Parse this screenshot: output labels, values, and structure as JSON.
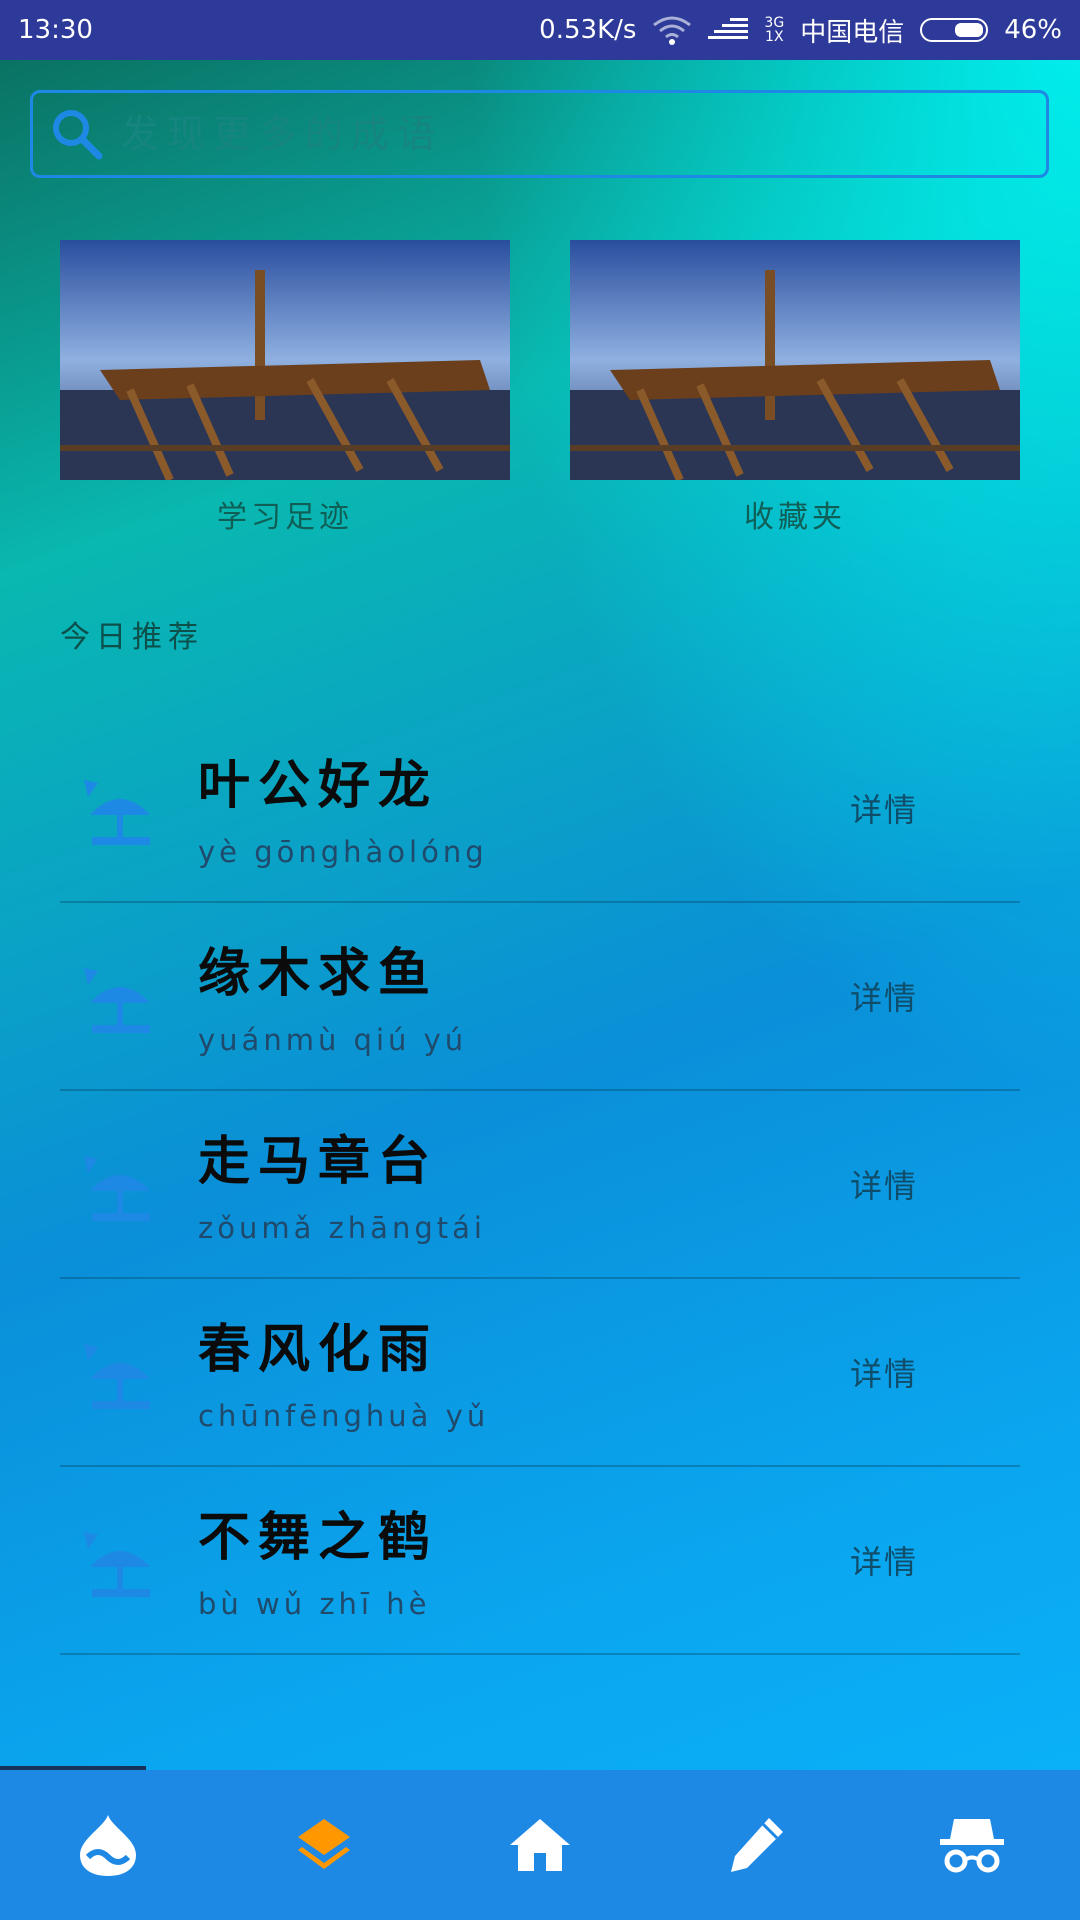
{
  "status_bar": {
    "time": "13:30",
    "speed": "0.53K/s",
    "net_top": "3G",
    "net_bottom": "1X",
    "carrier": "中国电信",
    "battery": "46%"
  },
  "search": {
    "placeholder": "发现更多的成语"
  },
  "tiles": [
    {
      "label": "学习足迹"
    },
    {
      "label": "收藏夹"
    }
  ],
  "section_title": "今日推荐",
  "list": [
    {
      "title": "叶公好龙",
      "pinyin": "yè gōnghàolóng",
      "detail": "详情"
    },
    {
      "title": "缘木求鱼",
      "pinyin": "yuánmù qiú yú",
      "detail": "详情"
    },
    {
      "title": "走马章台",
      "pinyin": "zǒumǎ zhāngtái",
      "detail": "详情"
    },
    {
      "title": "春风化雨",
      "pinyin": "chūnfēnghuà yǔ",
      "detail": "详情"
    },
    {
      "title": "不舞之鹤",
      "pinyin": "bù wǔ zhī hè",
      "detail": "详情"
    }
  ],
  "nav": {
    "items": [
      {
        "icon": "drupal-drop-icon"
      },
      {
        "icon": "layers-icon",
        "active": true
      },
      {
        "icon": "home-icon"
      },
      {
        "icon": "pencil-icon"
      },
      {
        "icon": "incognito-icon"
      }
    ],
    "active_color": "#ff9800",
    "icon_color": "#ffffff"
  }
}
